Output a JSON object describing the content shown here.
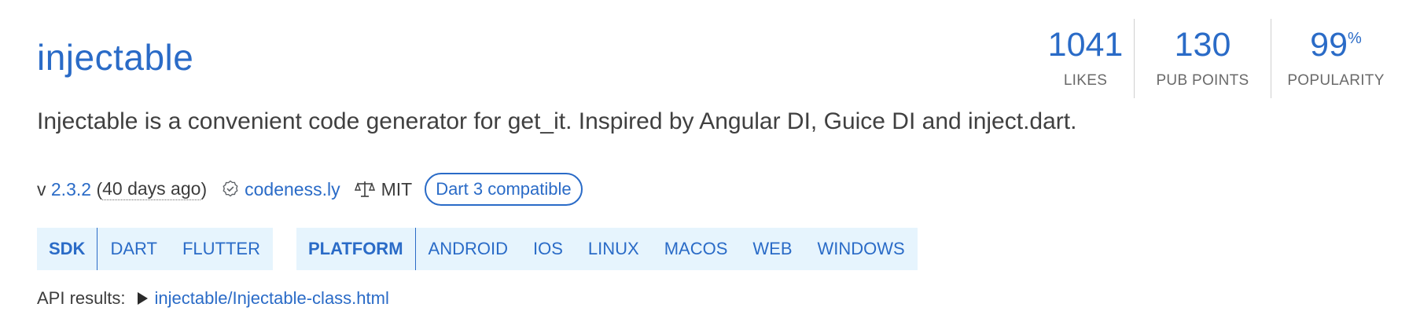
{
  "package": {
    "name": "injectable",
    "description": "Injectable is a convenient code generator for get_it. Inspired by Angular DI, Guice DI and inject.dart."
  },
  "metrics": [
    {
      "value": "1041",
      "suffix": "",
      "label": "LIKES"
    },
    {
      "value": "130",
      "suffix": "",
      "label": "PUB POINTS"
    },
    {
      "value": "99",
      "suffix": "%",
      "label": "POPULARITY"
    }
  ],
  "meta": {
    "version_prefix": "v",
    "version": "2.3.2",
    "age_open": "(",
    "age": "40 days ago",
    "age_close": ")",
    "publisher": "codeness.ly",
    "license": "MIT",
    "compat_badge": "Dart 3 compatible"
  },
  "tags": {
    "sdk": {
      "label": "SDK",
      "items": [
        "DART",
        "FLUTTER"
      ]
    },
    "platform": {
      "label": "PLATFORM",
      "items": [
        "ANDROID",
        "IOS",
        "LINUX",
        "MACOS",
        "WEB",
        "WINDOWS"
      ]
    }
  },
  "api": {
    "label": "API results:",
    "link": "injectable/Injectable-class.html"
  },
  "colors": {
    "accent": "#2a6bc7",
    "tag_background": "#e6f4fd",
    "text": "#3c3c3c"
  },
  "icons": {
    "publisher": "verified-publisher-icon",
    "license": "scale-balance-icon",
    "api_expand": "triangle-right-icon"
  }
}
